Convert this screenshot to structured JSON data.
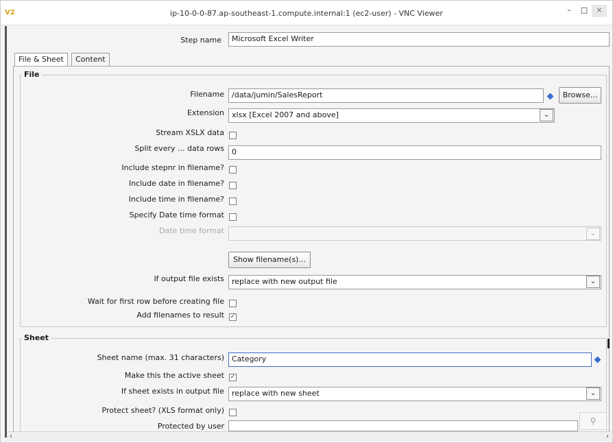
{
  "window": {
    "title": "ip-10-0-0-87.ap-southeast-1.compute.internal:1 (ec2-user) - VNC Viewer",
    "app_icon_text": "V2",
    "minimize_glyph": "–",
    "maximize_glyph": "□",
    "close_glyph": "×"
  },
  "step": {
    "label": "Step name",
    "value": "Microsoft Excel Writer"
  },
  "tabs": [
    {
      "label": "File & Sheet",
      "active": true
    },
    {
      "label": "Content",
      "active": false
    }
  ],
  "file_group": {
    "title": "File",
    "filename_label": "Filename",
    "filename_value": "/data/jumin/SalesReport",
    "browse_label": "Browse...",
    "extension_label": "Extension",
    "extension_value": "xlsx [Excel 2007 and above]",
    "stream_label": "Stream XSLX data",
    "stream_checked": false,
    "split_label": "Split every ... data rows",
    "split_value": "0",
    "stepnr_label": "Include stepnr in filename?",
    "stepnr_checked": false,
    "date_label": "Include date in filename?",
    "date_checked": false,
    "time_label": "Include time in filename?",
    "time_checked": false,
    "specify_format_label": "Specify Date time format",
    "specify_format_checked": false,
    "date_time_format_label": "Date time format",
    "date_time_format_value": "",
    "show_filenames_label": "Show filename(s)...",
    "if_exists_label": "If output file exists",
    "if_exists_value": "replace with new output file",
    "wait_label": "Wait for first row before creating file",
    "wait_checked": false,
    "add_filenames_label": "Add filenames to result",
    "add_filenames_checked": true
  },
  "sheet_group": {
    "title": "Sheet",
    "sheet_name_label": "Sheet name (max. 31 characters)",
    "sheet_name_value": "Category",
    "active_sheet_label": "Make this the active sheet",
    "active_sheet_checked": true,
    "sheet_exists_label": "If sheet exists in output file",
    "sheet_exists_value": "replace with new sheet",
    "protect_label": "Protect sheet? (XLS format only)",
    "protect_checked": false,
    "protected_by_label": "Protected by user",
    "protected_by_value": ""
  },
  "icons": {
    "dropdown": "chevron-down-icon",
    "variable": "variable-diamond-icon",
    "magnifier": "magnifier-icon"
  },
  "colors": {
    "accent": "#3a6fd0",
    "focus_border": "#3c6cbf"
  }
}
